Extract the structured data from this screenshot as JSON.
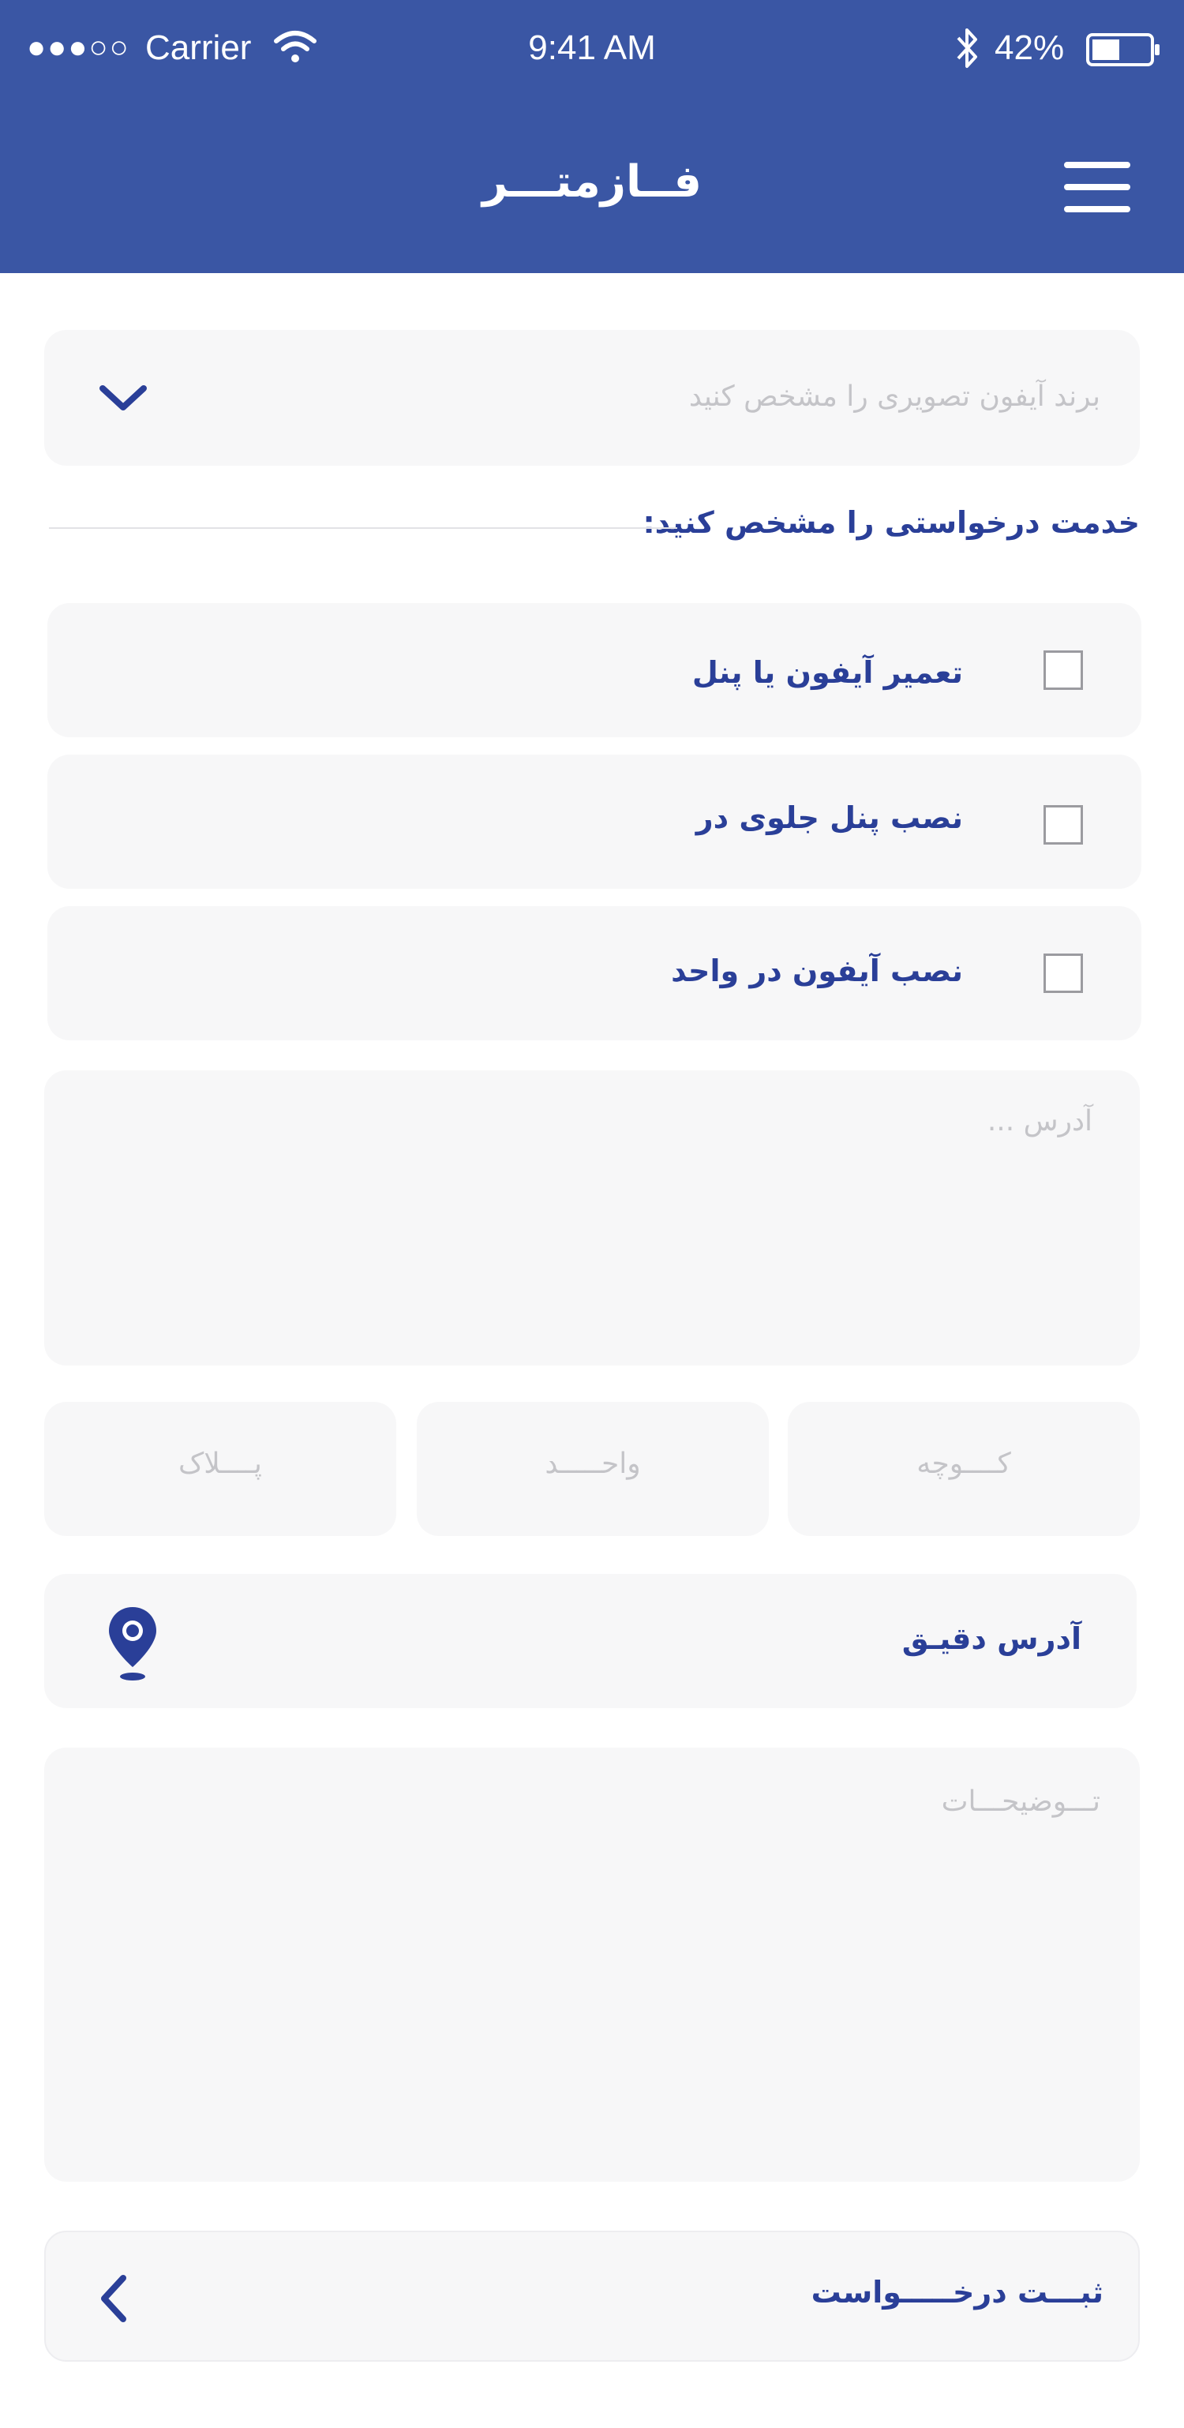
{
  "status_bar": {
    "signal": "●●●○○",
    "carrier": "Carrier",
    "time": "9:41 AM",
    "battery": "42%"
  },
  "header": {
    "title": "فــازمتـــر"
  },
  "brand_select": {
    "placeholder": "برند آیفون تصویری را مشخص کنید"
  },
  "services": {
    "heading": "خدمت درخواستی را مشخص کنید:",
    "items": [
      {
        "label": "تعمیر آیفون یا پنل",
        "checked": false
      },
      {
        "label": "نصب پنل جلوی در",
        "checked": false
      },
      {
        "label": "نصب آیفون در واحد",
        "checked": false
      }
    ]
  },
  "address": {
    "placeholder": "آدرس ..."
  },
  "address_parts": {
    "street": "کــــوچه",
    "unit": "واحـــــد",
    "plate": "پــــلاک"
  },
  "exact_address": {
    "label": "آدرس دقیـق"
  },
  "description": {
    "placeholder": "تـــوضیحـــات"
  },
  "submit": {
    "label": "ثبـــت درخـــــواست"
  },
  "colors": {
    "header_bg": "#3a56a4",
    "accent": "#2a3f98",
    "field_bg": "#f7f7f8",
    "placeholder": "#c4c4c8"
  }
}
